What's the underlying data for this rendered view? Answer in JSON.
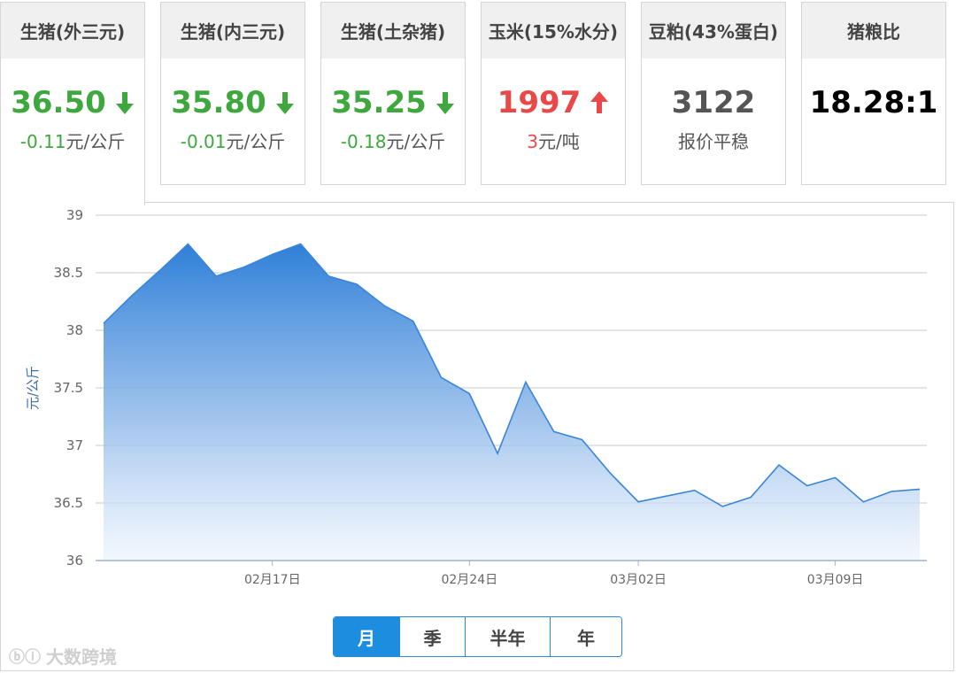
{
  "cards": [
    {
      "title": "生猪(外三元)",
      "value": "36.50",
      "trend": "down",
      "change": "-0.11",
      "unit": "元/公斤",
      "active": true
    },
    {
      "title": "生猪(内三元)",
      "value": "35.80",
      "trend": "down",
      "change": "-0.01",
      "unit": "元/公斤",
      "active": false
    },
    {
      "title": "生猪(土杂猪)",
      "value": "35.25",
      "trend": "down",
      "change": "-0.18",
      "unit": "元/公斤",
      "active": false
    },
    {
      "title": "玉米(15%水分)",
      "value": "1997",
      "trend": "up",
      "change": "3",
      "unit": "元/吨",
      "active": false
    },
    {
      "title": "豆粕(43%蛋白)",
      "value": "3122",
      "trend": "flat",
      "change": "",
      "unit": "报价平稳",
      "active": false
    },
    {
      "title": "猪粮比",
      "value": "18.28:1",
      "trend": "none",
      "change": "",
      "unit": "",
      "active": false
    }
  ],
  "colors": {
    "down": "#3ea83e",
    "up": "#ea4848",
    "accent": "#1d8de0"
  },
  "chart_data": {
    "type": "area",
    "ylabel": "元/公斤",
    "xlabel": "",
    "ylim": [
      36,
      39
    ],
    "yticks": [
      "36",
      "36.5",
      "37",
      "37.5",
      "38",
      "38.5",
      "39"
    ],
    "grid": true,
    "xtick_labels": [
      "02月17日",
      "02月24日",
      "03月02日",
      "03月09日"
    ],
    "x": [
      "02月11日",
      "02月12日",
      "02月13日",
      "02月14日",
      "02月15日",
      "02月16日",
      "02月17日",
      "02月18日",
      "02月19日",
      "02月20日",
      "02月21日",
      "02月22日",
      "02月23日",
      "02月24日",
      "02月25日",
      "02月26日",
      "02月27日",
      "02月28日",
      "03月01日",
      "03月02日",
      "03月03日",
      "03月04日",
      "03月05日",
      "03月06日",
      "03月07日",
      "03月08日",
      "03月09日",
      "03月10日",
      "03月11日",
      "03月12日"
    ],
    "series": [
      {
        "values": [
          38.06,
          38.3,
          38.52,
          38.75,
          38.47,
          38.55,
          38.66,
          38.75,
          38.47,
          38.4,
          38.21,
          38.08,
          37.59,
          37.45,
          36.93,
          37.55,
          37.12,
          37.05,
          36.76,
          36.51,
          36.56,
          36.61,
          36.47,
          36.55,
          36.83,
          36.65,
          36.72,
          36.51,
          36.6,
          36.62
        ]
      }
    ]
  },
  "periods": [
    {
      "label": "月",
      "active": true
    },
    {
      "label": "季",
      "active": false
    },
    {
      "label": "半年",
      "active": false
    },
    {
      "label": "年",
      "active": false
    }
  ],
  "watermark": "大数跨境",
  "watermark_logo": "ⓑⓘ"
}
